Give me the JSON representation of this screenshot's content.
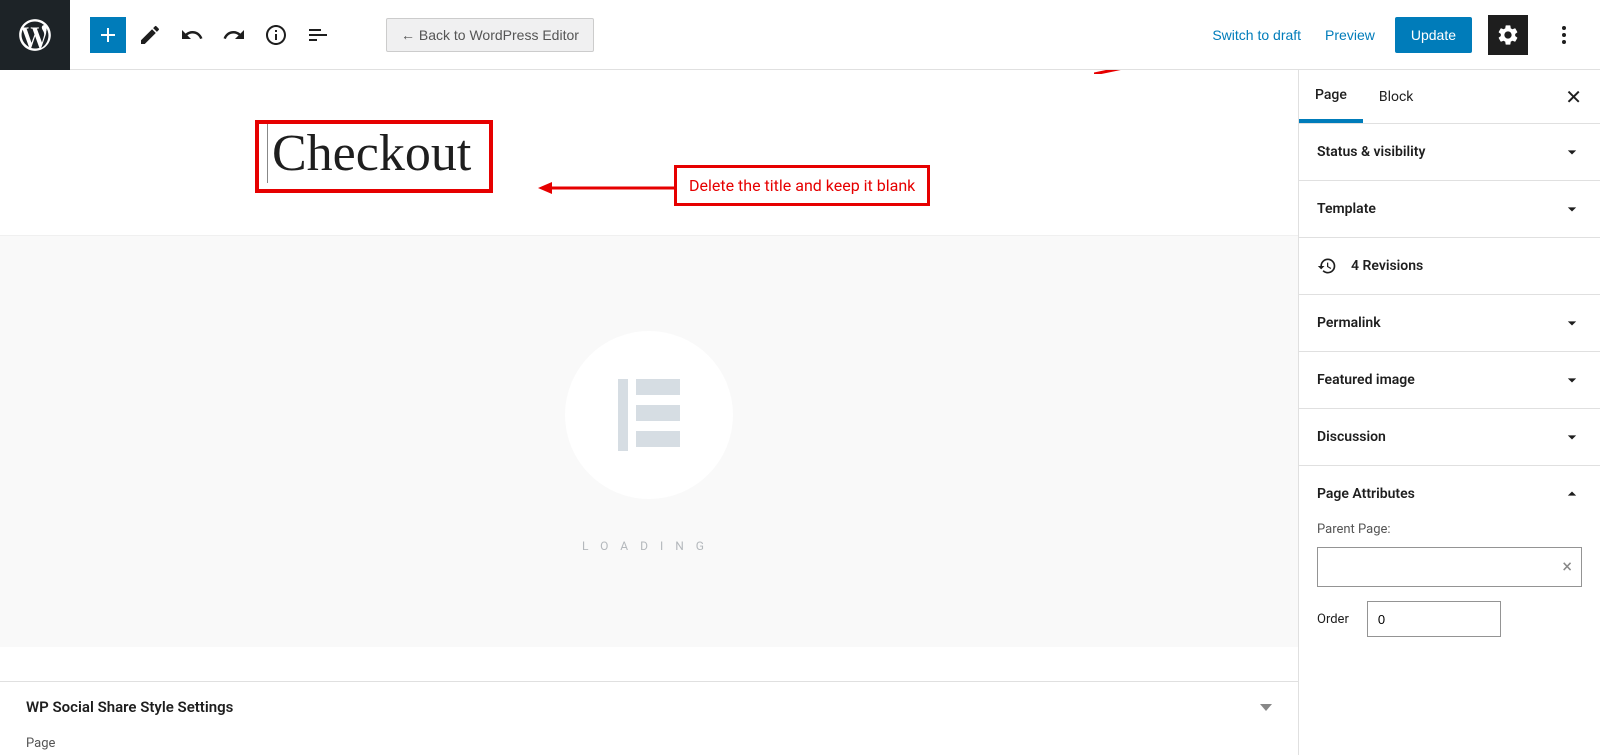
{
  "toolbar": {
    "back_label": "←  Back to WordPress Editor",
    "switch_draft": "Switch to draft",
    "preview": "Preview",
    "update": "Update"
  },
  "page_title": "Checkout",
  "annotation": "Delete the title and keep it blank",
  "loading_text": "LOADING",
  "meta_box": {
    "title": "WP Social Share Style Settings",
    "footer": "Page"
  },
  "sidebar": {
    "tabs": {
      "page": "Page",
      "block": "Block"
    },
    "panels": {
      "status": "Status & visibility",
      "template": "Template",
      "revisions": "4 Revisions",
      "permalink": "Permalink",
      "featured_image": "Featured image",
      "discussion": "Discussion",
      "page_attributes": "Page Attributes"
    },
    "page_attributes": {
      "parent_label": "Parent Page:",
      "order_label": "Order",
      "order_value": "0"
    }
  }
}
